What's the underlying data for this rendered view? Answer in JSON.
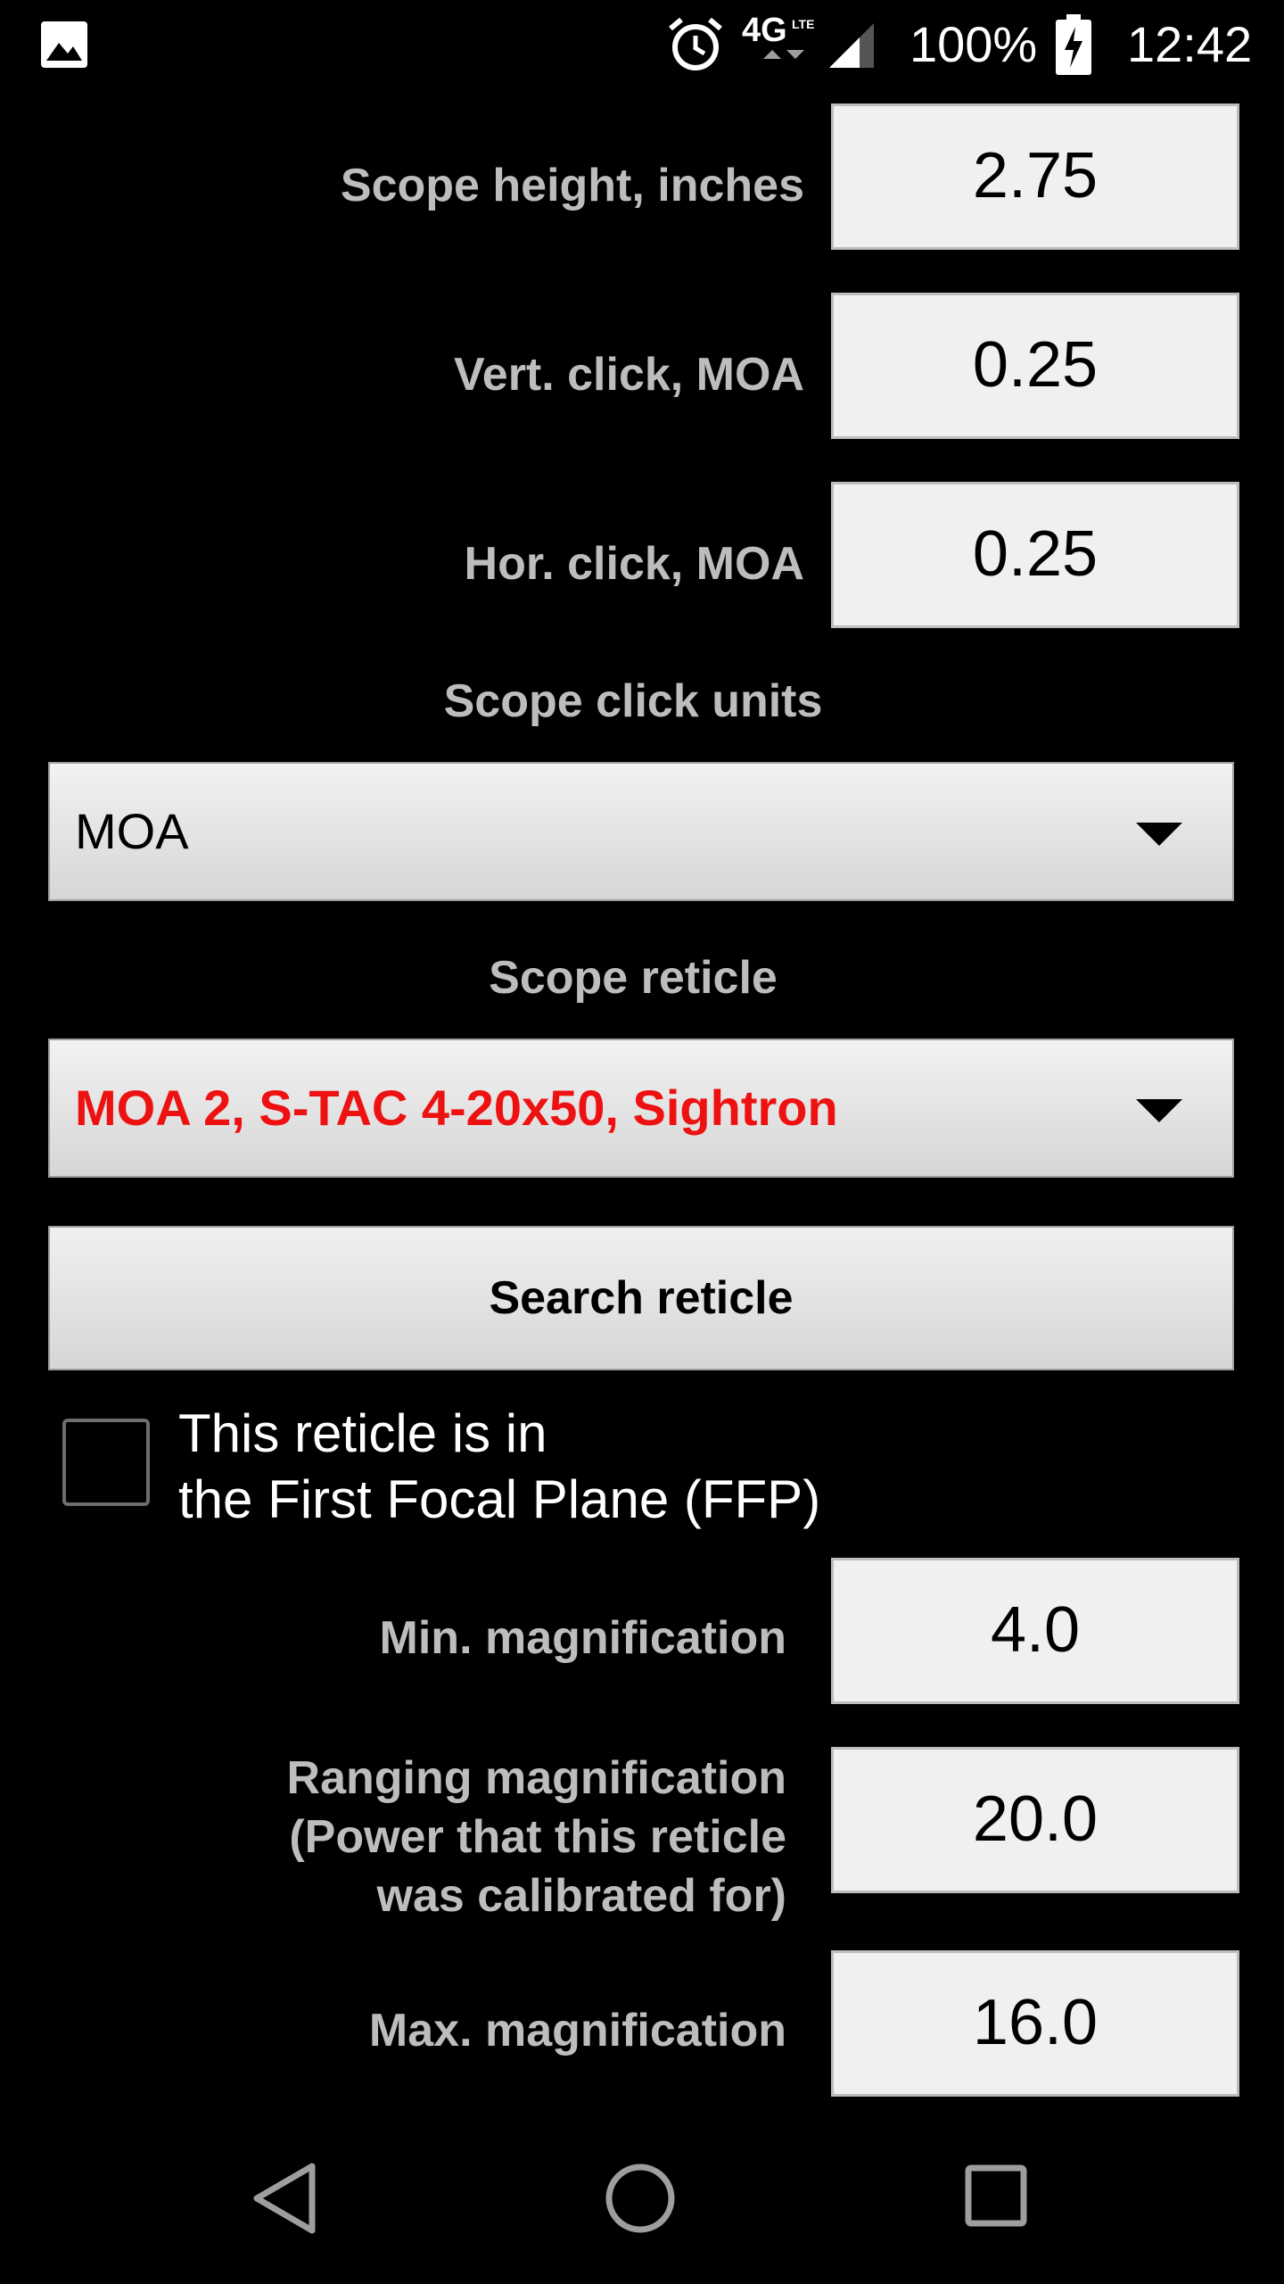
{
  "status_bar": {
    "battery": "100%",
    "time": "12:42",
    "network": "4G LTE",
    "icons": [
      "image-icon",
      "alarm-icon",
      "network-4g-icon",
      "signal-icon",
      "battery-charging-icon"
    ]
  },
  "fields": {
    "scope_height": {
      "label": "Scope height, inches",
      "value": "2.75"
    },
    "vert_click": {
      "label": "Vert. click, MOA",
      "value": "0.25"
    },
    "hor_click": {
      "label": "Hor. click, MOA",
      "value": "0.25"
    }
  },
  "click_units": {
    "label": "Scope click units",
    "selected": "MOA"
  },
  "reticle": {
    "label": "Scope reticle",
    "selected": "MOA 2, S-TAC 4-20x50, Sightron",
    "color": "#ee1111"
  },
  "search_button": {
    "label": "Search reticle"
  },
  "ffp_checkbox": {
    "line1": "This reticle is in",
    "line2": "the First Focal Plane (FFP)",
    "checked": false
  },
  "magnification": {
    "min": {
      "label": "Min. magnification",
      "value": "4.0"
    },
    "ranging": {
      "line1": "Ranging magnification",
      "line2": "(Power that this reticle",
      "line3": "was calibrated for)",
      "value": "20.0"
    },
    "max": {
      "label": "Max. magnification",
      "value": "16.0"
    }
  },
  "nav_bar": {
    "icons": [
      "back-icon",
      "home-icon",
      "recents-icon"
    ]
  }
}
